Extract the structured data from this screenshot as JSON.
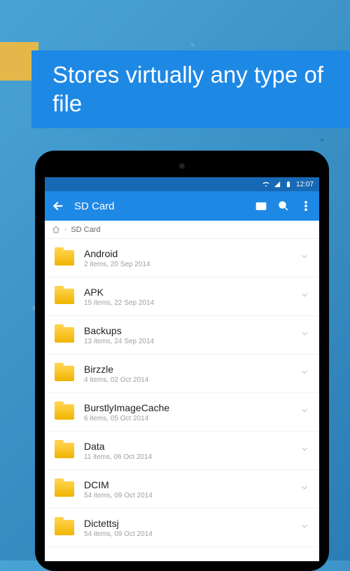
{
  "promo": {
    "headline_bold": "Stores",
    "headline_rest": " virtually any type of file"
  },
  "status": {
    "time": "12:07"
  },
  "appbar": {
    "title": "SD Card"
  },
  "breadcrumb": {
    "here": "SD Card"
  },
  "files": [
    {
      "name": "Android",
      "sub": "2 items, 20 Sep 2014"
    },
    {
      "name": "APK",
      "sub": "15 items, 22 Sep 2014"
    },
    {
      "name": "Backups",
      "sub": "13 items, 24 Sep 2014"
    },
    {
      "name": "Birzzle",
      "sub": "4 items, 02 Oct 2014"
    },
    {
      "name": "BurstlyImageCache",
      "sub": "6 items, 05 Oct 2014"
    },
    {
      "name": "Data",
      "sub": "11 items, 06 Oct 2014"
    },
    {
      "name": "DCIM",
      "sub": "54 items, 09 Oct 2014"
    },
    {
      "name": "Dictettsj",
      "sub": "54 items, 09 Oct 2014"
    }
  ]
}
